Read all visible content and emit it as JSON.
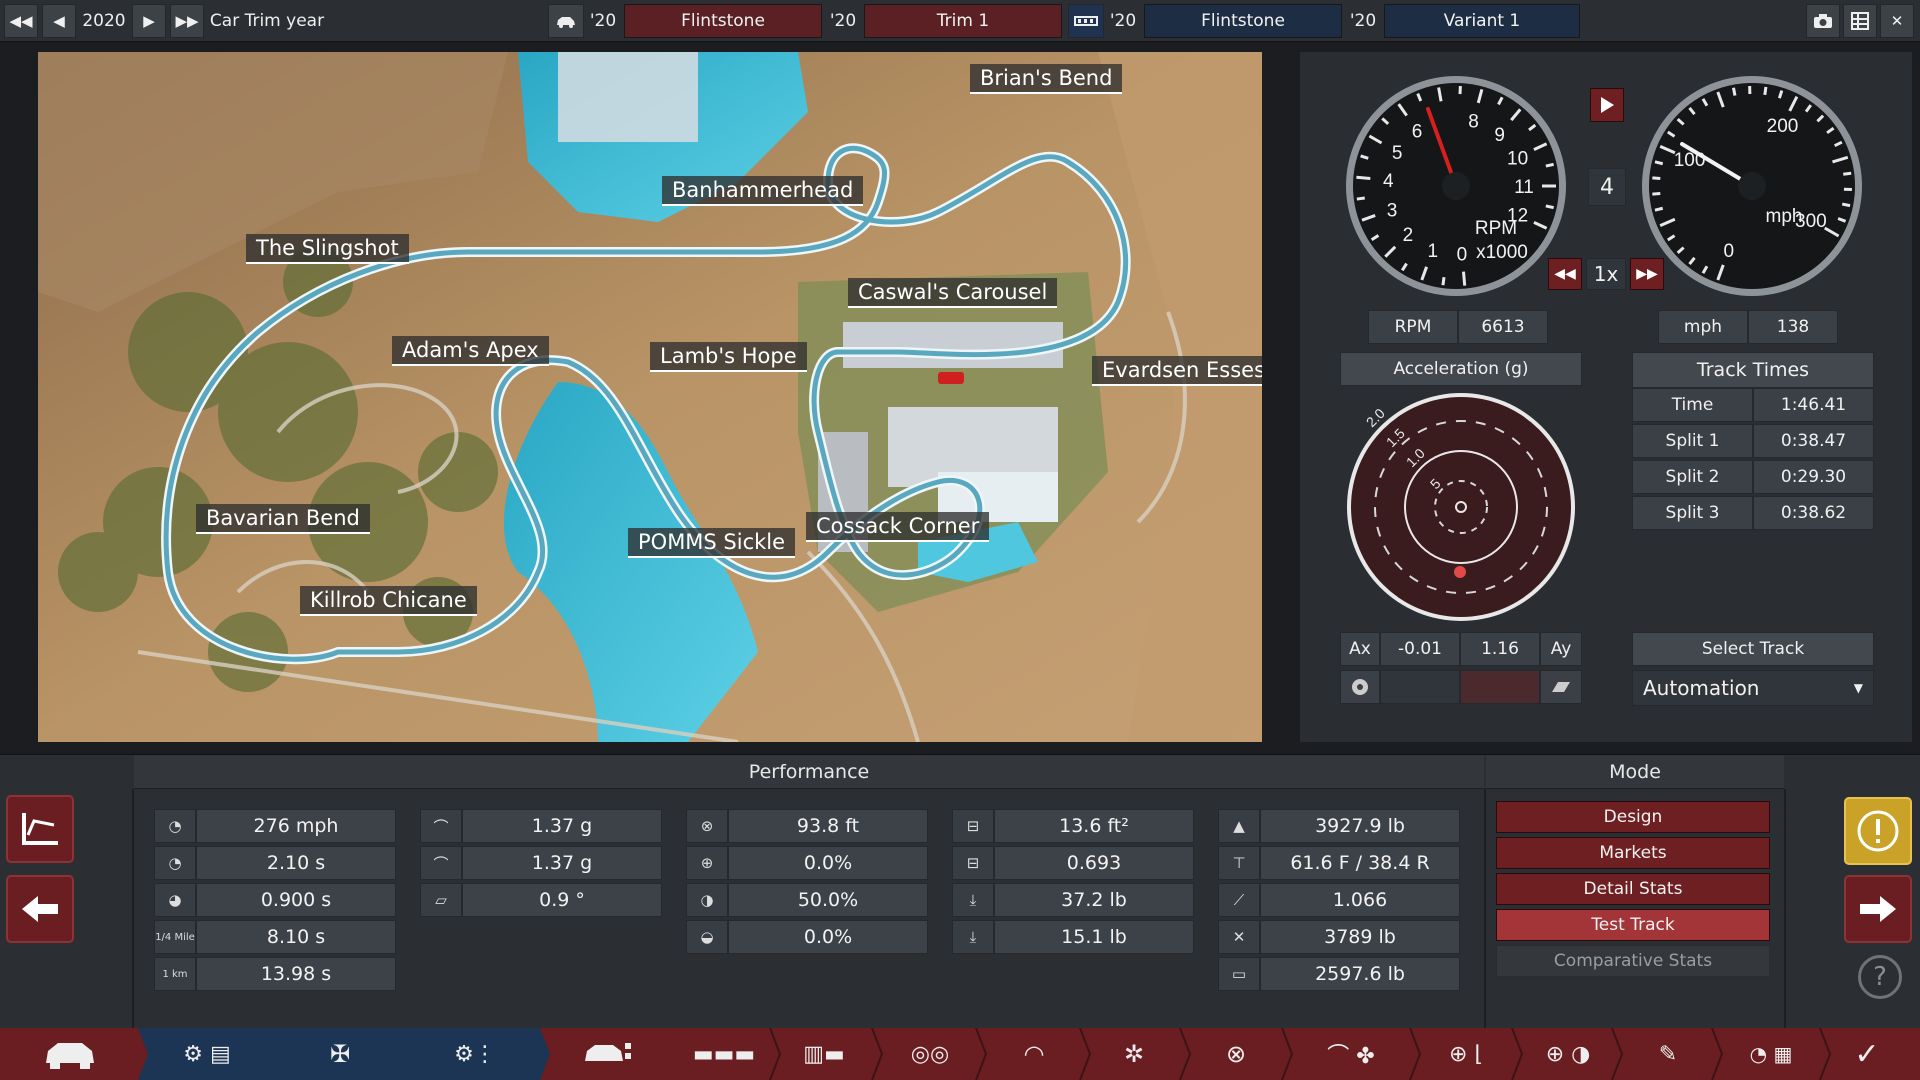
{
  "topbar": {
    "year": "2020",
    "car_trim_year_label": "Car Trim year",
    "model_year": "'20",
    "model_name": "Flintstone",
    "trim_year": "'20",
    "trim_name": "Trim 1",
    "engine_year": "'20",
    "engine_family": "Flintstone",
    "variant_year": "'20",
    "variant_name": "Variant 1"
  },
  "map": {
    "labels": {
      "brians_bend": "Brian's Bend",
      "banhammerhead": "Banhammerhead",
      "slingshot": "The Slingshot",
      "caswals_carousel": "Caswal's Carousel",
      "adams_apex": "Adam's Apex",
      "lambs_hope": "Lamb's Hope",
      "evardsen_esses": "Evardsen Esses",
      "bavarian_bend": "Bavarian Bend",
      "pomms_sickle": "POMMS Sickle",
      "cossack_corner": "Cossack Corner",
      "killrob_chicane": "Killrob Chicane"
    }
  },
  "tachometer": {
    "ticks": [
      "0",
      "1",
      "2",
      "3",
      "4",
      "5",
      "6",
      "8",
      "9",
      "10",
      "11",
      "12"
    ],
    "unit_line1": "RPM",
    "unit_line2": "x1000",
    "redline_value": 6.6
  },
  "gear": "4",
  "speedometer": {
    "ticks": [
      "0",
      "100",
      "200",
      "300"
    ],
    "unit": "mph"
  },
  "playback": {
    "speed": "1x"
  },
  "readouts": {
    "rpm_label": "RPM",
    "rpm_value": "6613",
    "speed_label": "mph",
    "speed_value": "138"
  },
  "acceleration": {
    "title": "Acceleration (g)",
    "ring_labels": [
      "2.0",
      "1.5",
      "1.0",
      "5"
    ],
    "ax_label": "Ax",
    "ax_value": "-0.01",
    "ay_value": "1.16",
    "ay_label": "Ay"
  },
  "track_times": {
    "title": "Track Times",
    "rows": [
      {
        "label": "Time",
        "value": "1:46.41"
      },
      {
        "label": "Split 1",
        "value": "0:38.47"
      },
      {
        "label": "Split 2",
        "value": "0:29.30"
      },
      {
        "label": "Split 3",
        "value": "0:38.62"
      }
    ],
    "select_track": "Select Track",
    "automation": "Automation"
  },
  "performance": {
    "title": "Performance",
    "col1": [
      "276 mph",
      "2.10 s",
      "0.900 s",
      "8.10 s",
      "13.98 s"
    ],
    "col1_icon_text": {
      "quarter_mile": "1/4 Mile",
      "km": "1 km"
    },
    "col2": [
      "1.37 g",
      "1.37 g",
      "0.9 °"
    ],
    "col3": [
      "93.8 ft",
      "0.0%",
      "50.0%",
      "0.0%"
    ],
    "col4": [
      "13.6 ft²",
      "0.693",
      "37.2 lb",
      "15.1 lb"
    ],
    "col5": [
      "3927.9 lb",
      "61.6 F / 38.4 R",
      "1.066",
      "3789 lb",
      "2597.6 lb"
    ]
  },
  "mode": {
    "title": "Mode",
    "buttons": [
      "Design",
      "Markets",
      "Detail Stats",
      "Test Track",
      "Comparative Stats"
    ],
    "active": "Test Track"
  },
  "help_label": "?"
}
